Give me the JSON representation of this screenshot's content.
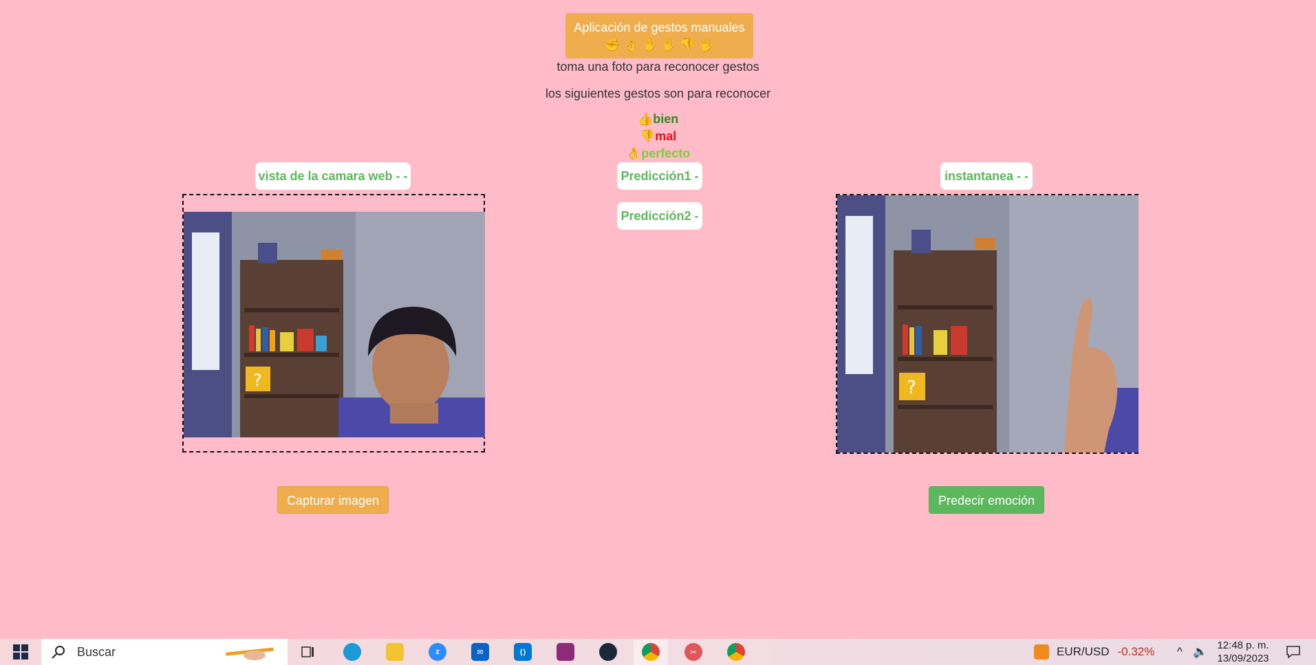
{
  "header": {
    "title": "Aplicación de gestos manuales",
    "gesture_icons": [
      "✊",
      "👌",
      "✋",
      "✋",
      "👎",
      "🖐"
    ]
  },
  "instructions": {
    "line1": "toma una foto para reconocer gestos",
    "line2": "los siguientes gestos son para reconocer"
  },
  "gestures": [
    {
      "icon": "👍",
      "label": "bien",
      "color": "#2e8b23"
    },
    {
      "icon": "👎",
      "label": "mal",
      "color": "#e8121a"
    },
    {
      "icon": "👌",
      "label": "perfecto",
      "color": "#7ecb3c"
    }
  ],
  "webcam": {
    "label": "vista de la camara web - -"
  },
  "snapshot": {
    "label": "instantanea - -"
  },
  "predictions": {
    "p1": "Predicción1 -",
    "p2": "Predicción2 -"
  },
  "buttons": {
    "capture": "Capturar imagen",
    "predict": "Predecir emoción"
  },
  "colors": {
    "background": "#ffbcc8",
    "warning": "#f0ad4e",
    "success": "#5cb85c"
  },
  "taskbar": {
    "search_placeholder": "Buscar",
    "apps": [
      "start-icon",
      "task-view-icon",
      "edge-icon",
      "file-explorer-icon",
      "zoom-icon",
      "mail-icon",
      "vscode-icon",
      "winrar-icon",
      "steam-icon",
      "chrome-icon",
      "snipping-tool-icon",
      "chrome-icon"
    ],
    "ticker_label": "EUR/USD",
    "ticker_change": "-0.32%",
    "time": "12:48 p. m.",
    "date": "13/09/2023"
  }
}
